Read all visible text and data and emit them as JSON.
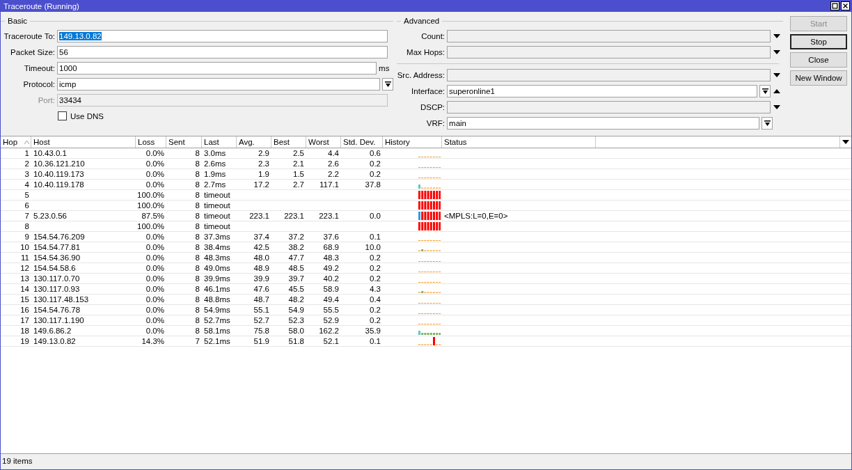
{
  "window": {
    "title": "Traceroute (Running)"
  },
  "basic": {
    "title": "Basic",
    "fields": [
      {
        "label": "Traceroute To:",
        "value": "149.13.0.82",
        "kind": "text",
        "highlighted": true,
        "disabled": false
      },
      {
        "label": "Packet Size:",
        "value": "56",
        "kind": "text",
        "highlighted": false,
        "disabled": false
      },
      {
        "label": "Timeout:",
        "value": "1000",
        "kind": "text",
        "unit": "ms",
        "highlighted": false,
        "disabled": false
      },
      {
        "label": "Protocol:",
        "value": "icmp",
        "kind": "select",
        "highlighted": false,
        "disabled": false
      },
      {
        "label": "Port:",
        "value": "33434",
        "kind": "text",
        "highlighted": false,
        "disabled": true
      }
    ],
    "use_dns": {
      "label": "Use DNS",
      "checked": false
    }
  },
  "advanced": {
    "title": "Advanced",
    "groups": [
      [
        {
          "label": "Count:",
          "kind": "unset"
        },
        {
          "label": "Max Hops:",
          "kind": "unset"
        }
      ],
      [
        {
          "label": "Src. Address:",
          "kind": "unset"
        },
        {
          "label": "Interface:",
          "value": "superonline1",
          "kind": "set"
        },
        {
          "label": "DSCP:",
          "kind": "unset"
        },
        {
          "label": "VRF:",
          "value": "main",
          "kind": "fixed"
        }
      ]
    ]
  },
  "buttons": [
    {
      "label": "Start",
      "disabled": true,
      "focused": false
    },
    {
      "label": "Stop",
      "disabled": false,
      "focused": true
    },
    {
      "label": "Close",
      "disabled": false,
      "focused": false
    },
    {
      "label": "New Window",
      "disabled": false,
      "focused": false
    }
  ],
  "table": {
    "columns": [
      {
        "label": "Hop",
        "sorted": true
      },
      {
        "label": "Host",
        "sorted": false
      },
      {
        "label": "Loss",
        "sorted": false
      },
      {
        "label": "Sent",
        "sorted": false
      },
      {
        "label": "Last",
        "sorted": false
      },
      {
        "label": "Avg.",
        "sorted": false
      },
      {
        "label": "Best",
        "sorted": false
      },
      {
        "label": "Worst",
        "sorted": false
      },
      {
        "label": "Std. Dev.",
        "sorted": false
      },
      {
        "label": "History",
        "sorted": false
      },
      {
        "label": "Status",
        "sorted": false
      }
    ],
    "rows": [
      {
        "hop": "1",
        "host": "10.43.0.1",
        "loss": "0.0%",
        "sent": "8",
        "last": "3.0ms",
        "avg": "2.9",
        "best": "2.5",
        "worst": "4.4",
        "std_dev": "0.6",
        "kind": "flat"
      },
      {
        "hop": "2",
        "host": "10.36.121.210",
        "loss": "0.0%",
        "sent": "8",
        "last": "2.6ms",
        "avg": "2.3",
        "best": "2.1",
        "worst": "2.6",
        "std_dev": "0.2",
        "kind": "flat"
      },
      {
        "hop": "3",
        "host": "10.40.119.173",
        "loss": "0.0%",
        "sent": "8",
        "last": "1.9ms",
        "avg": "1.9",
        "best": "1.5",
        "worst": "2.2",
        "std_dev": "0.2",
        "kind": "flat"
      },
      {
        "hop": "4",
        "host": "10.40.119.178",
        "loss": "0.0%",
        "sent": "8",
        "last": "2.7ms",
        "avg": "17.2",
        "best": "2.7",
        "worst": "117.1",
        "std_dev": "37.8",
        "kind": "spike"
      },
      {
        "hop": "5",
        "loss": "100.0%",
        "sent": "8",
        "last": "timeout",
        "kind": "lost"
      },
      {
        "hop": "6",
        "loss": "100.0%",
        "sent": "8",
        "last": "timeout",
        "kind": "lost"
      },
      {
        "hop": "7",
        "host": "5.23.0.56",
        "loss": "87.5%",
        "sent": "8",
        "last": "timeout",
        "avg": "223.1",
        "best": "223.1",
        "worst": "223.1",
        "std_dev": "0.0",
        "kind": "lossy",
        "status": "<MPLS:L=0,E=0>"
      },
      {
        "hop": "8",
        "loss": "100.0%",
        "sent": "8",
        "last": "timeout",
        "kind": "lost"
      },
      {
        "hop": "9",
        "host": "154.54.76.209",
        "loss": "0.0%",
        "sent": "8",
        "last": "37.3ms",
        "avg": "37.4",
        "best": "37.2",
        "worst": "37.6",
        "std_dev": "0.1",
        "kind": "flat"
      },
      {
        "hop": "10",
        "host": "154.54.77.81",
        "loss": "0.0%",
        "sent": "8",
        "last": "38.4ms",
        "avg": "42.5",
        "best": "38.2",
        "worst": "68.9",
        "std_dev": "10.0",
        "kind": "bump"
      },
      {
        "hop": "11",
        "host": "154.54.36.90",
        "loss": "0.0%",
        "sent": "8",
        "last": "48.3ms",
        "avg": "48.0",
        "best": "47.7",
        "worst": "48.3",
        "std_dev": "0.2",
        "kind": "flat"
      },
      {
        "hop": "12",
        "host": "154.54.58.6",
        "loss": "0.0%",
        "sent": "8",
        "last": "49.0ms",
        "avg": "48.9",
        "best": "48.5",
        "worst": "49.2",
        "std_dev": "0.2",
        "kind": "flat"
      },
      {
        "hop": "13",
        "host": "130.117.0.70",
        "loss": "0.0%",
        "sent": "8",
        "last": "39.9ms",
        "avg": "39.9",
        "best": "39.7",
        "worst": "40.2",
        "std_dev": "0.2",
        "kind": "flat"
      },
      {
        "hop": "14",
        "host": "130.117.0.93",
        "loss": "0.0%",
        "sent": "8",
        "last": "46.1ms",
        "avg": "47.6",
        "best": "45.5",
        "worst": "58.9",
        "std_dev": "4.3",
        "kind": "bump"
      },
      {
        "hop": "15",
        "host": "130.117.48.153",
        "loss": "0.0%",
        "sent": "8",
        "last": "48.8ms",
        "avg": "48.7",
        "best": "48.2",
        "worst": "49.4",
        "std_dev": "0.4",
        "kind": "flat"
      },
      {
        "hop": "16",
        "host": "154.54.76.78",
        "loss": "0.0%",
        "sent": "8",
        "last": "54.9ms",
        "avg": "55.1",
        "best": "54.9",
        "worst": "55.5",
        "std_dev": "0.2",
        "kind": "flat"
      },
      {
        "hop": "17",
        "host": "130.117.1.190",
        "loss": "0.0%",
        "sent": "8",
        "last": "52.7ms",
        "avg": "52.7",
        "best": "52.3",
        "worst": "52.9",
        "std_dev": "0.2",
        "kind": "flat"
      },
      {
        "hop": "18",
        "host": "149.6.86.2",
        "loss": "0.0%",
        "sent": "8",
        "last": "58.1ms",
        "avg": "75.8",
        "best": "58.0",
        "worst": "162.2",
        "std_dev": "35.9",
        "kind": "raised"
      },
      {
        "hop": "19",
        "host": "149.13.0.82",
        "loss": "14.3%",
        "sent": "7",
        "last": "52.1ms",
        "avg": "51.9",
        "best": "51.8",
        "worst": "52.1",
        "std_dev": "0.1",
        "kind": "dropped"
      }
    ]
  },
  "status_bar": {
    "text": "19 items"
  }
}
